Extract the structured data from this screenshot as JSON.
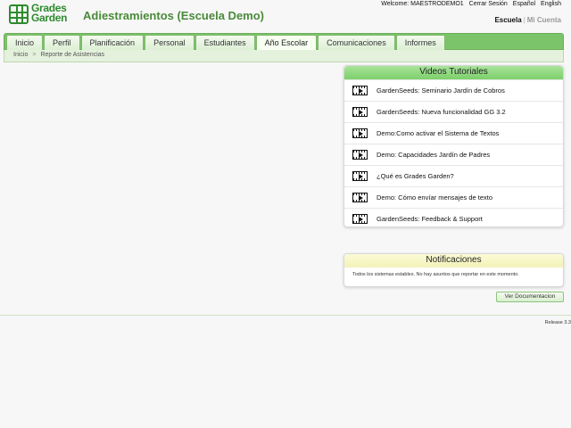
{
  "header": {
    "logo_text_line1": "Grades",
    "logo_text_line2": "Garden",
    "app_title": "Adiestramientos (Escuela Demo)",
    "welcome": "Welcome: MAESTRODEMO1",
    "logout": "Cerrar Sesión",
    "lang_es": "Español",
    "lang_en": "English",
    "context_active": "Escuela",
    "context_separator": "|",
    "context_other": "Mi Cuenta"
  },
  "nav": {
    "tabs": [
      {
        "label": "Inicio"
      },
      {
        "label": "Perfil"
      },
      {
        "label": "Planificación"
      },
      {
        "label": "Personal"
      },
      {
        "label": "Estudiantes"
      },
      {
        "label": "Año Escolar"
      },
      {
        "label": "Comunicaciones"
      },
      {
        "label": "Informes"
      }
    ],
    "active_tab": "Año Escolar"
  },
  "breadcrumb": {
    "home": "Inicio",
    "separator": ">",
    "current": "Reporte de Asistencias"
  },
  "videos": {
    "title": "Videos Tutoriales",
    "items": [
      {
        "label": "GardenSeeds: Seminario Jardín de Cobros",
        "icon": "video-icon"
      },
      {
        "label": "GardenSeeds: Nueva funcionalidad GG 3.2",
        "icon": "video-icon"
      },
      {
        "label": "Demo:Como activar el Sistema de Textos",
        "icon": "video-icon"
      },
      {
        "label": "Demo: Capacidades Jardín de Padres",
        "icon": "video-icon"
      },
      {
        "label": "¿Qué es Grades Garden?",
        "icon": "video-icon"
      },
      {
        "label": "Demo: Cómo envíar mensajes de texto",
        "icon": "video-icon"
      },
      {
        "label": "GardenSeeds: Feedback & Support",
        "icon": "video-icon"
      }
    ]
  },
  "notifications": {
    "title": "Notificaciones",
    "message": "Todos los sistemas estables. No hay asuntos que reportar en este momento."
  },
  "doc_button": "Ver Documentacion",
  "release": "Release 3.3",
  "colors": {
    "brand_green": "#2e8b2e",
    "nav_green": "#7cc46a",
    "title_green": "#4a8a3a",
    "notif_yellow": "#f3f2b8"
  }
}
